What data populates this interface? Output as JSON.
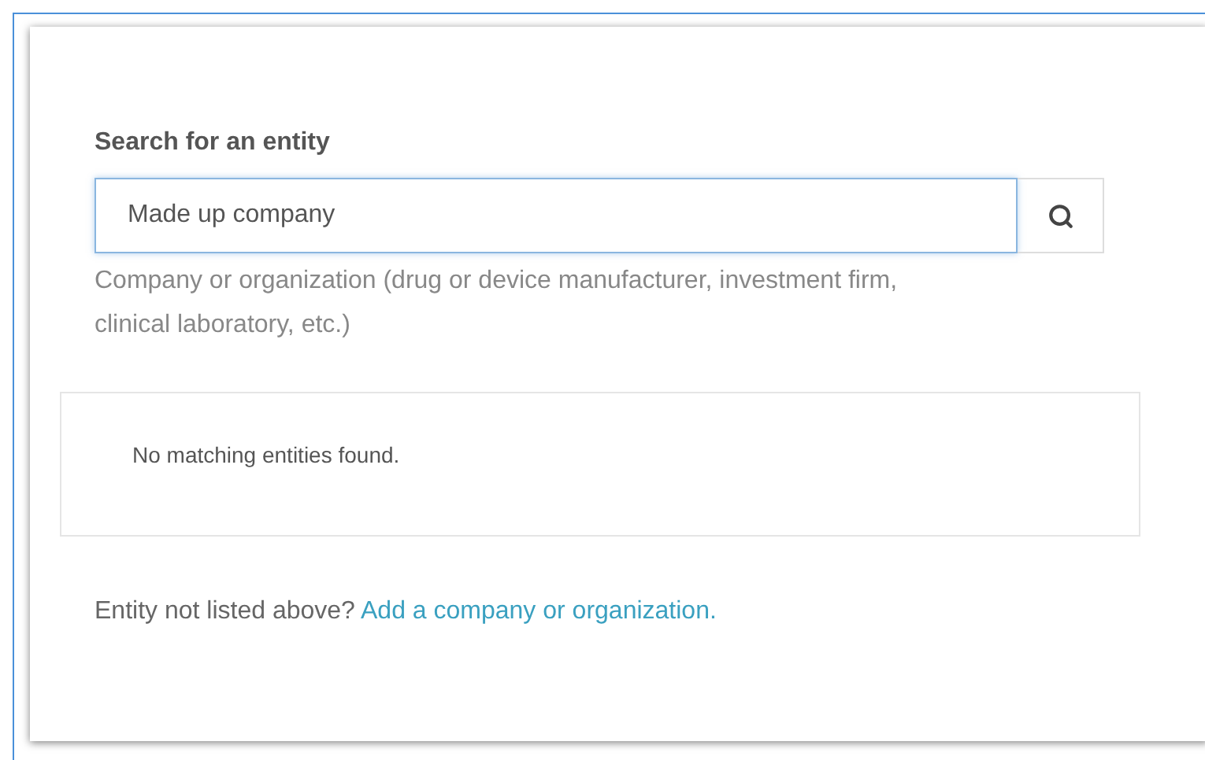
{
  "search": {
    "label": "Search for an entity",
    "value": "Made up company",
    "help": "Company or organization (drug or device manufacturer, investment firm, clinical laboratory, etc.)"
  },
  "results": {
    "message": "No matching entities found."
  },
  "footer": {
    "text": "Entity not listed above?",
    "link": "Add a company or organization."
  }
}
